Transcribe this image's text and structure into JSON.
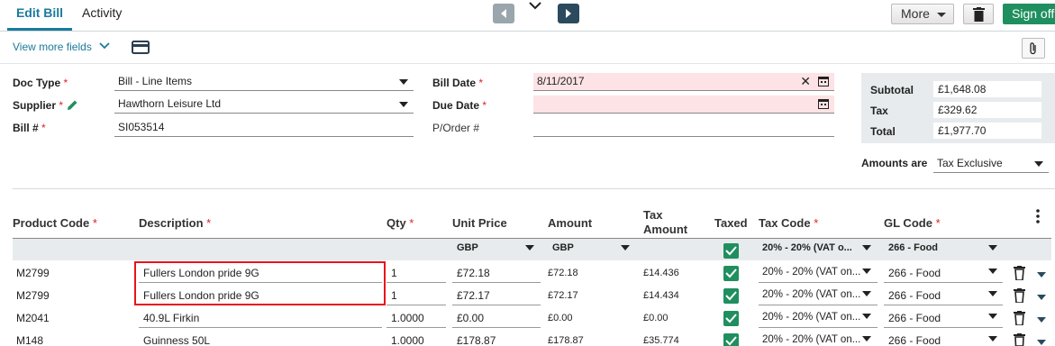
{
  "tabs": {
    "edit": "Edit Bill",
    "activity": "Activity"
  },
  "toolbar": {
    "more": "More",
    "sign_off": "Sign off"
  },
  "view_more": "View more fields",
  "form": {
    "doc_type_label": "Doc Type",
    "doc_type_value": "Bill - Line Items",
    "supplier_label": "Supplier",
    "supplier_value": "Hawthorn Leisure Ltd",
    "bill_no_label": "Bill #",
    "bill_no_value": "SI053514",
    "bill_date_label": "Bill Date",
    "bill_date_value": "8/11/2017",
    "due_date_label": "Due Date",
    "due_date_value": "",
    "porder_label": "P/Order #",
    "porder_value": "",
    "req": "*"
  },
  "totals": {
    "subtotal_label": "Subtotal",
    "subtotal": "£1,648.08",
    "tax_label": "Tax",
    "tax": "£329.62",
    "total_label": "Total",
    "total": "£1,977.70",
    "amounts_are_label": "Amounts are",
    "amounts_are": "Tax Exclusive"
  },
  "table": {
    "headers": {
      "product_code": "Product Code",
      "description": "Description",
      "qty": "Qty",
      "unit_price": "Unit Price",
      "amount": "Amount",
      "tax_amount_1": "Tax",
      "tax_amount_2": "Amount",
      "taxed": "Taxed",
      "tax_code": "Tax Code",
      "gl_code": "GL Code"
    },
    "filters": {
      "unit_price": "GBP",
      "amount": "GBP",
      "tax_code": "20% - 20% (VAT o...",
      "gl_code": "266 - Food"
    },
    "rows": [
      {
        "code": "M2799",
        "desc": "Fullers London pride 9G",
        "qty": "1",
        "unit": "£72.18",
        "amount": "£72.18",
        "tax": "£14.436",
        "tax_code": "20% - 20% (VAT on...",
        "gl": "266 - Food"
      },
      {
        "code": "M2799",
        "desc": "Fullers London pride 9G",
        "qty": "1",
        "unit": "£72.17",
        "amount": "£72.17",
        "tax": "£14.434",
        "tax_code": "20% - 20% (VAT on...",
        "gl": "266 - Food"
      },
      {
        "code": "M2041",
        "desc": "40.9L Firkin",
        "qty": "1.0000",
        "unit": "£0.00",
        "amount": "£0.00",
        "tax": "£0.00",
        "tax_code": "20% - 20% (VAT on...",
        "gl": "266 - Food"
      },
      {
        "code": "M148",
        "desc": "Guinness  50L",
        "qty": "1.0000",
        "unit": "£178.87",
        "amount": "£178.87",
        "tax": "£35.774",
        "tax_code": "20% - 20% (VAT on...",
        "gl": "266 - Food"
      }
    ]
  },
  "colors": {
    "accent": "#1b7a9b",
    "primary_green": "#1f8f5f",
    "required": "#dd2222",
    "highlight": "#e8141b",
    "pink_field": "#fde3e5"
  }
}
